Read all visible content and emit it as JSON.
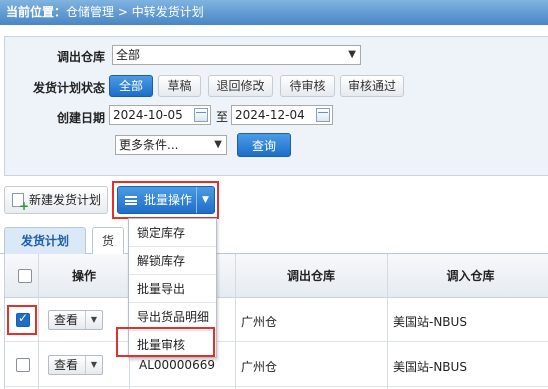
{
  "breadcrumb": {
    "prefix": "当前位置：",
    "path": "仓储管理 > 中转发货计划"
  },
  "filters": {
    "warehouse_label": "调出仓库",
    "warehouse_value": "全部",
    "status_label": "发货计划状态",
    "status_options": [
      "全部",
      "草稿",
      "退回修改",
      "待审核",
      "审核通过"
    ],
    "status_active_index": 0,
    "date_label": "创建日期",
    "date_from": "2024-10-05",
    "date_sep": "至",
    "date_to": "2024-12-04",
    "more_conditions": "更多条件...",
    "query_label": "查询"
  },
  "toolbar": {
    "new_plan_label": "新建发货计划",
    "batch_label": "批量操作"
  },
  "batch_menu": {
    "items": [
      "锁定库存",
      "解锁库存",
      "批量导出",
      "导出货品明细",
      "批量审核"
    ],
    "highlighted_index": 4
  },
  "tabs": [
    {
      "label": "发货计划",
      "active": true
    },
    {
      "label": "货",
      "active": false
    }
  ],
  "grid": {
    "columns": [
      "操作",
      "调出仓库",
      "调入仓库"
    ],
    "view_label": "查看",
    "rows": [
      {
        "checked": true,
        "code": "",
        "from": "广州仓",
        "to": "美国站-NBUS"
      },
      {
        "checked": false,
        "code": "AL00000669",
        "from": "广州仓",
        "to": "美国站-NBUS"
      }
    ]
  },
  "colors": {
    "accent": "#1d6ec8",
    "highlight": "#e0312b",
    "header": "#4a86c5"
  }
}
